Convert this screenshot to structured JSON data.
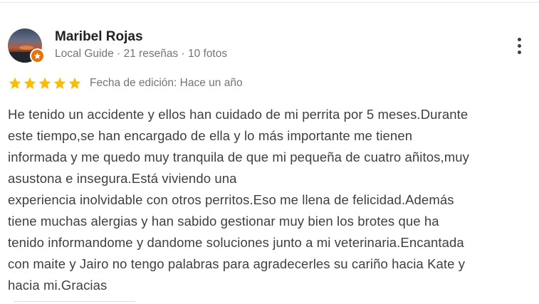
{
  "reviewer": {
    "name": "Maribel Rojas",
    "meta": "Local Guide · 21 reseñas · 10 fotos",
    "badge_icon": "local-guide-star-icon",
    "badge_color": "#e8710a"
  },
  "rating": {
    "stars": 5,
    "max": 5,
    "star_color": "#fbbc04",
    "date": "Fecha de edición: Hace un año"
  },
  "review": {
    "lines": [
      "He tenido un accidente y ellos han cuidado de mi perrita por 5 meses.Durante",
      "este tiempo,se han encargado de ella y lo más importante me tienen",
      "informada y me quedo muy tranquila de que mi pequeña de cuatro añitos,muy",
      "asustona e insegura.Está viviendo una",
      "experiencia inolvidable con otros perritos.Eso me llena de felicidad.Además",
      "tiene muchas alergias y han sabido gestionar muy bien los brotes que ha",
      "tenido informandome y dandome soluciones junto a mi veterinaria.Encantada",
      "con maite y Jairo no tengo palabras para agradecerles su cariño hacia Kate y",
      "hacia mi.Gracias"
    ]
  },
  "menu": {
    "icon": "more-vert-icon"
  }
}
